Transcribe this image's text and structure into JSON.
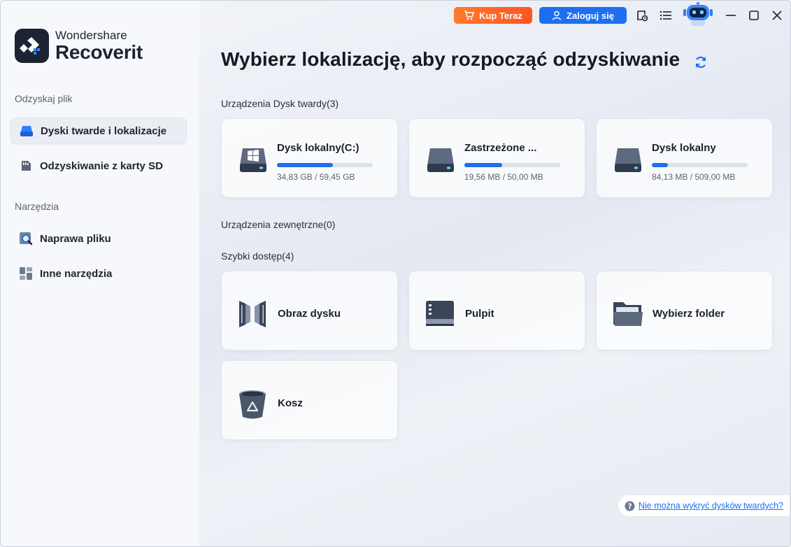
{
  "app": {
    "brand_top": "Wondershare",
    "brand_bottom": "Recoverit"
  },
  "sidebar": {
    "section_recover": "Odzyskaj plik",
    "section_tools": "Narzędzia",
    "items": [
      {
        "label": "Dyski twarde i lokalizacje",
        "icon": "hard-drive-icon",
        "active": true
      },
      {
        "label": "Odzyskiwanie z karty SD",
        "icon": "sd-card-icon",
        "active": false
      },
      {
        "label": "Naprawa pliku",
        "icon": "file-repair-icon",
        "active": false
      },
      {
        "label": "Inne narzędzia",
        "icon": "tools-grid-icon",
        "active": false
      }
    ]
  },
  "topbar": {
    "buy_label": "Kup Teraz",
    "login_label": "Zaloguj się"
  },
  "main": {
    "title": "Wybierz lokalizację, aby rozpocząć odzyskiwanie",
    "hard_drives_label": "Urządzenia Dysk twardy(3)",
    "external_label": "Urządzenia zewnętrzne(0)",
    "quick_access_label": "Szybki dostęp(4)",
    "drives": [
      {
        "name": "Dysk lokalny(C:)",
        "size": "34,83 GB / 59,45 GB",
        "usage": 0.586,
        "icon": "windows-drive-icon"
      },
      {
        "name": "Zastrzeżone ...",
        "size": "19,56 MB / 50,00 MB",
        "usage": 0.391,
        "icon": "drive-icon"
      },
      {
        "name": "Dysk lokalny",
        "size": "84,13 MB / 509,00 MB",
        "usage": 0.165,
        "icon": "drive-icon"
      }
    ],
    "quick_access": [
      {
        "label": "Obraz dysku",
        "icon": "disk-image-icon"
      },
      {
        "label": "Pulpit",
        "icon": "desktop-icon"
      },
      {
        "label": "Wybierz folder",
        "icon": "folder-icon"
      },
      {
        "label": "Kosz",
        "icon": "recycle-bin-icon"
      }
    ]
  },
  "help": {
    "link": "Nie można wykryć dysków twardych?"
  },
  "colors": {
    "accent": "#1e6ff0",
    "buy": "#ff6424",
    "sidebar_bg": "#f7f8fb"
  }
}
